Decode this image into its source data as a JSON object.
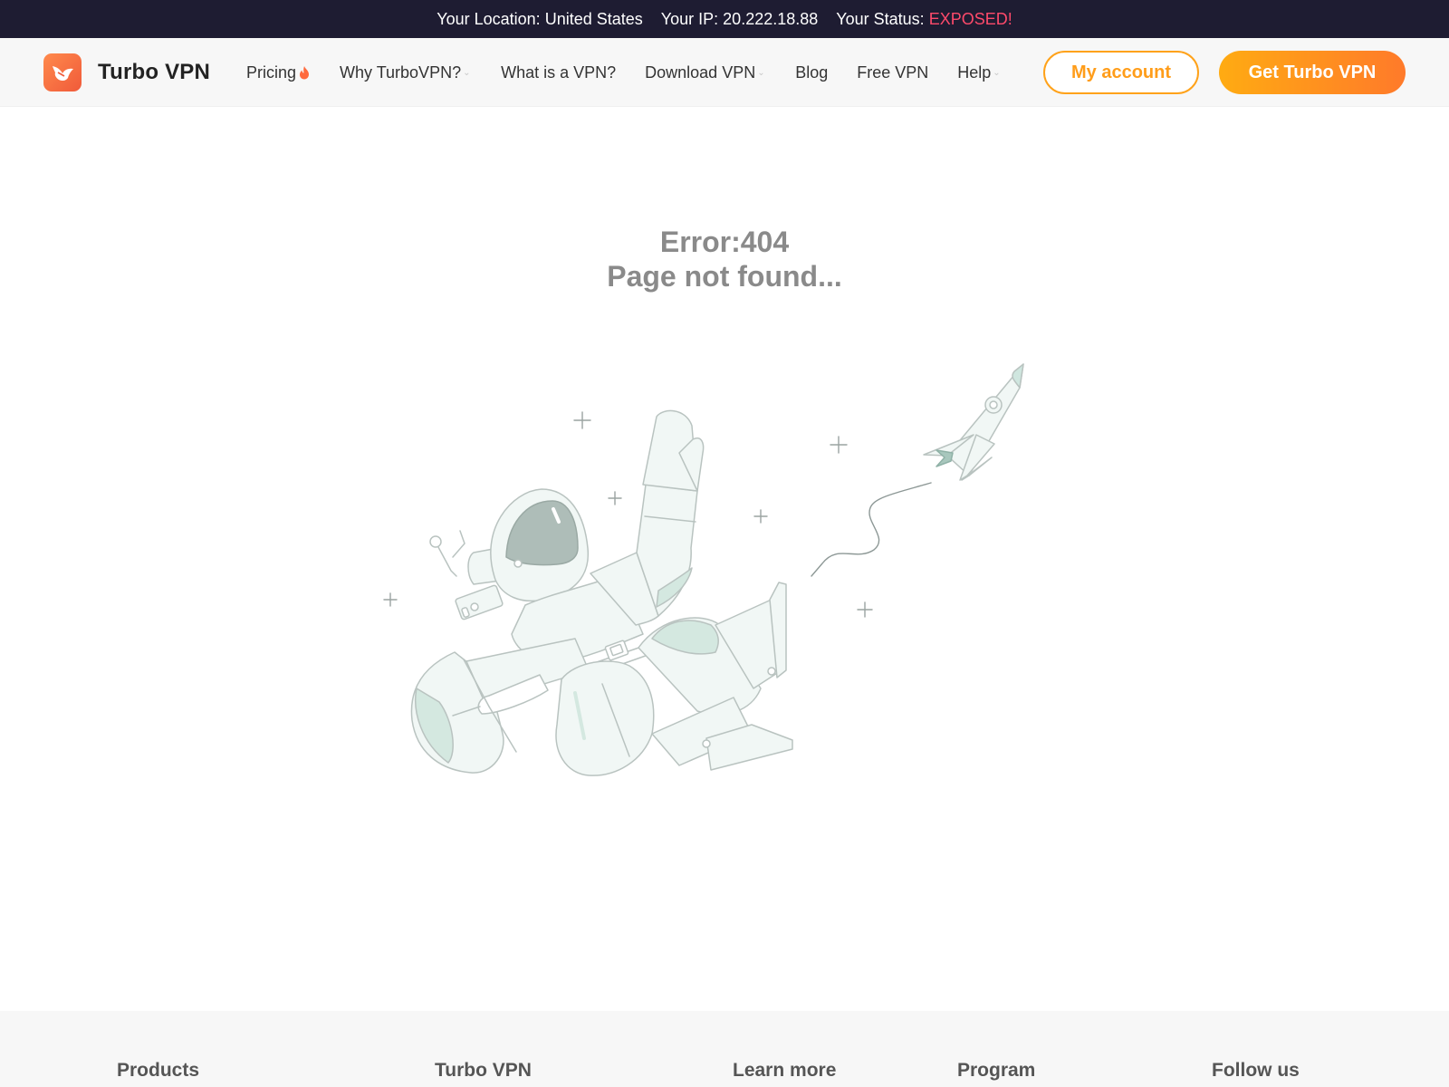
{
  "topbar": {
    "location_label": "Your Location:",
    "location_value": "United States",
    "ip_label": "Your IP:",
    "ip_value": "20.222.18.88",
    "status_label": "Your Status:",
    "status_value": "EXPOSED!",
    "status_color": "#ff4a6b"
  },
  "header": {
    "brand": "Turbo VPN",
    "nav": [
      {
        "label": "Pricing",
        "icon": "fire-icon",
        "dropdown": false
      },
      {
        "label": "Why TurboVPN?",
        "dropdown": true
      },
      {
        "label": "What is a VPN?",
        "dropdown": false
      },
      {
        "label": "Download VPN",
        "dropdown": true
      },
      {
        "label": "Blog",
        "dropdown": false
      },
      {
        "label": "Free VPN",
        "dropdown": false
      },
      {
        "label": "Help",
        "dropdown": true
      }
    ],
    "account_button": "My account",
    "cta_button": "Get Turbo VPN",
    "accent_color": "#ff9d1a"
  },
  "main": {
    "error_code": "Error:404",
    "error_message": "Page not found...",
    "illustration": "astronaut-rocket-illustration"
  },
  "footer": {
    "columns": [
      "Products",
      "Turbo VPN",
      "Learn more",
      "Program",
      "Follow us"
    ]
  }
}
